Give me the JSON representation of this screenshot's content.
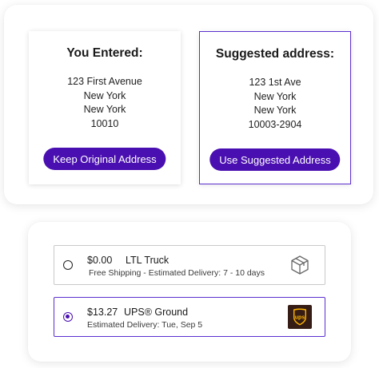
{
  "address_panel": {
    "entered": {
      "title": "You Entered:",
      "lines": [
        "123 First Avenue",
        "New York",
        "New York",
        "10010"
      ],
      "button_label": "Keep Original Address"
    },
    "suggested": {
      "title": "Suggested address:",
      "lines": [
        "123 1st Ave",
        "New York",
        "New York",
        "10003-2904"
      ],
      "button_label": "Use Suggested Address"
    }
  },
  "shipping_panel": {
    "options": [
      {
        "selected": false,
        "price": "$0.00",
        "carrier": "LTL Truck",
        "detail": "Free Shipping - Estimated Delivery: 7 - 10 days",
        "icon": "box-icon"
      },
      {
        "selected": true,
        "price": "$13.27",
        "carrier": "UPS® Ground",
        "detail": "Estimated Delivery: Tue, Sep 5",
        "icon": "ups-logo"
      }
    ]
  },
  "colors": {
    "accent": "#4a0fb0",
    "selected_border": "#5b2fd0",
    "ups_brown": "#351c15",
    "ups_gold": "#ffb500"
  }
}
